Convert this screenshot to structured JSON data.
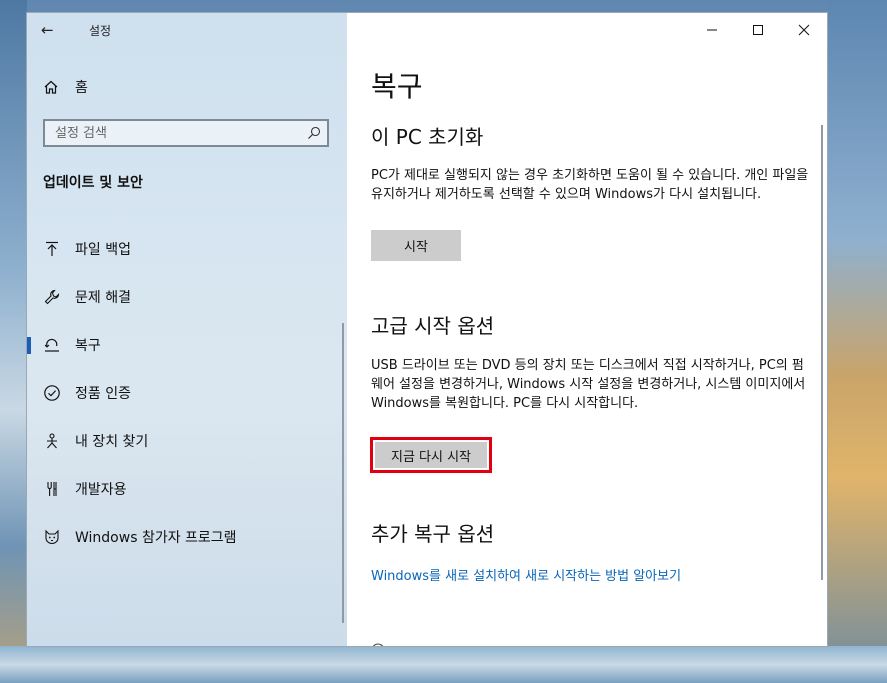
{
  "window": {
    "title": "설정",
    "back_label": "←"
  },
  "sidebar": {
    "home_label": "홈",
    "search_placeholder": "설정 검색",
    "section_title": "업데이트 및 보안",
    "items": [
      {
        "label": "파일 백업",
        "icon": "upload-icon",
        "active": false
      },
      {
        "label": "문제 해결",
        "icon": "wrench-icon",
        "active": false
      },
      {
        "label": "복구",
        "icon": "recovery-icon",
        "active": true
      },
      {
        "label": "정품 인증",
        "icon": "check-circle-icon",
        "active": false
      },
      {
        "label": "내 장치 찾기",
        "icon": "find-device-icon",
        "active": false
      },
      {
        "label": "개발자용",
        "icon": "developer-icon",
        "active": false
      },
      {
        "label": "Windows 참가자 프로그램",
        "icon": "insider-cat-icon",
        "active": false
      }
    ]
  },
  "content": {
    "page_title": "복구",
    "reset_title": "이 PC 초기화",
    "reset_desc": "PC가 제대로 실행되지 않는 경우 초기화하면 도움이 될 수 있습니다. 개인 파일을 유지하거나 제거하도록 선택할 수 있으며 Windows가 다시 설치됩니다.",
    "reset_button": "시작",
    "advanced_title": "고급 시작 옵션",
    "advanced_desc": "USB 드라이브 또는 DVD 등의 장치 또는 디스크에서 직접 시작하거나, PC의 펌웨어 설정을 변경하거나, Windows 시작 설정을 변경하거나, 시스템 이미지에서 Windows를 복원합니다. PC를 다시 시작합니다.",
    "restart_button": "지금 다시 시작",
    "more_title": "추가 복구 옵션",
    "more_link": "Windows를 새로 설치하여 새로 시작하는 방법 알아보기"
  },
  "colors": {
    "accent": "#1a5fb4",
    "link": "#0a66b8",
    "highlight_border": "#e00012",
    "button_bg": "#cccccc"
  }
}
